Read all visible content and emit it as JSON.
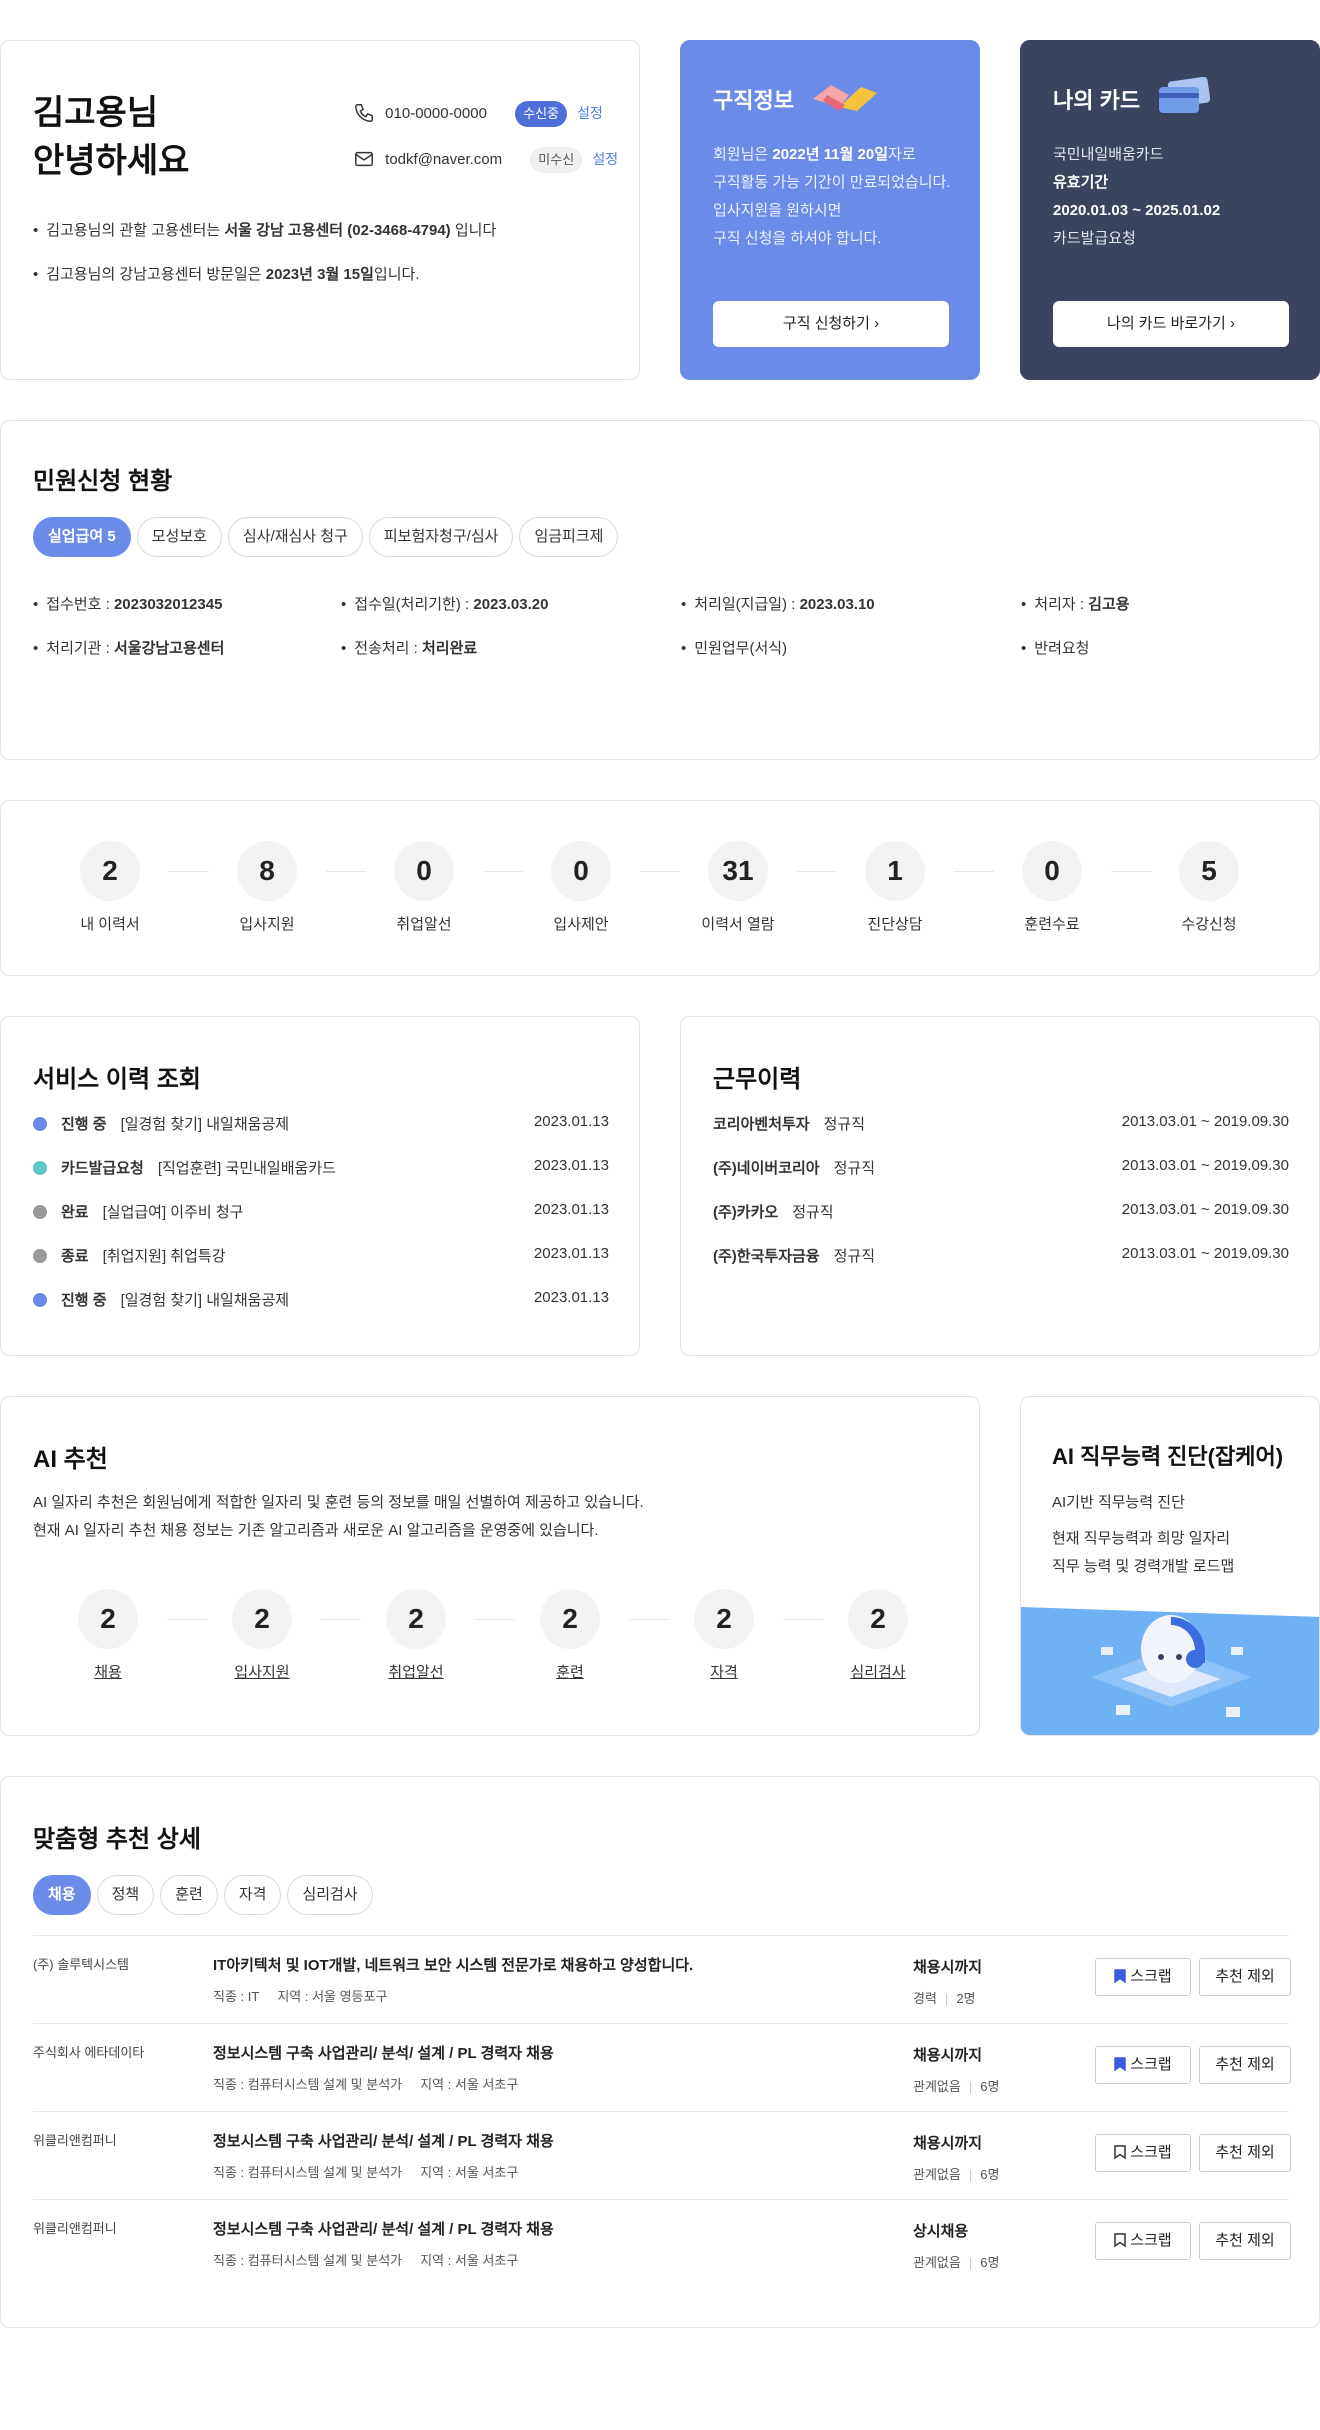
{
  "profile": {
    "greeting_line1": "김고용님",
    "greeting_line2": "안녕하세요",
    "phone": "010-0000-0000",
    "phone_badge": "수신중",
    "phone_setting": "설정",
    "email": "todkf@naver.com",
    "email_badge": "미수신",
    "email_setting": "설정",
    "info1_pre": "김고용님의 관할 고용센터는 ",
    "info1_bold": "서울 강남 고용센터 (02-3468-4794)",
    "info1_post": " 입니다",
    "info2_pre": "김고용님의 강남고용센터 방문일은 ",
    "info2_bold": "2023년 3월 15일",
    "info2_post": "입니다."
  },
  "job_info": {
    "title": "구직정보",
    "l1_pre": "회원님은 ",
    "l1_bold": "2022년 11월 20일",
    "l1_post": "자로",
    "l2": "구직활동 가능 기간이 만료되었습니다.",
    "l3": "입사지원을 원하시면",
    "l4": "구직 신청을 하셔야 합니다.",
    "button": "구직 신청하기",
    "colors": {
      "bg": "#6b8be8"
    }
  },
  "my_card": {
    "title": "나의 카드",
    "l1": "국민내일배움카드",
    "l2": "유효기간",
    "l3": "2020.01.03 ~ 2025.01.02",
    "l4": "카드발급요청",
    "button": "나의 카드 바로가기",
    "colors": {
      "bg": "#3a4460"
    }
  },
  "civil": {
    "title": "민원신청 현황",
    "tabs": [
      "실업급여 5",
      "모성보호",
      "심사/재심사 청구",
      "피보험자청구/심사",
      "임금피크제"
    ],
    "items": [
      {
        "label": "접수번호 : ",
        "value": "2023032012345"
      },
      {
        "label": "접수일(처리기한) : ",
        "value": "2023.03.20"
      },
      {
        "label": "처리일(지급일) : ",
        "value": "2023.03.10"
      },
      {
        "label": "처리자 : ",
        "value": "김고용"
      },
      {
        "label": "처리기관 : ",
        "value": "서울강남고용센터"
      },
      {
        "label": "전송처리 : ",
        "value": "처리완료"
      },
      {
        "label": "민원업무(서식)",
        "value": ""
      },
      {
        "label": "반려요청",
        "value": ""
      }
    ]
  },
  "stats": [
    {
      "value": "2",
      "label": "내 이력서"
    },
    {
      "value": "8",
      "label": "입사지원"
    },
    {
      "value": "0",
      "label": "취업알선"
    },
    {
      "value": "0",
      "label": "입사제안"
    },
    {
      "value": "31",
      "label": "이력서 열람"
    },
    {
      "value": "1",
      "label": "진단상담"
    },
    {
      "value": "0",
      "label": "훈련수료"
    },
    {
      "value": "5",
      "label": "수강신청"
    }
  ],
  "service": {
    "title": "서비스 이력 조회",
    "rows": [
      {
        "status": "진행 중",
        "text": "[일경험 찾기] 내일채움공제",
        "date": "2023.01.13",
        "color": "#6b8be8"
      },
      {
        "status": "카드발급요청",
        "text": "[직업훈련] 국민내일배움카드",
        "date": "2023.01.13",
        "color": "#5ec7c9"
      },
      {
        "status": "완료",
        "text": "[실업급여] 이주비 청구",
        "date": "2023.01.13",
        "color": "#9a9a9a"
      },
      {
        "status": "종료",
        "text": "[취업지원] 취업특강",
        "date": "2023.01.13",
        "color": "#9a9a9a"
      },
      {
        "status": "진행 중",
        "text": "[일경험 찾기] 내일채움공제",
        "date": "2023.01.13",
        "color": "#6b8be8"
      }
    ]
  },
  "work": {
    "title": "근무이력",
    "rows": [
      {
        "company": "코리아벤처투자",
        "type": "정규직",
        "period": "2013.03.01 ~ 2019.09.30"
      },
      {
        "company": "(주)네이버코리아",
        "type": "정규직",
        "period": "2013.03.01 ~ 2019.09.30"
      },
      {
        "company": "(주)카카오",
        "type": "정규직",
        "period": "2013.03.01 ~ 2019.09.30"
      },
      {
        "company": "(주)한국투자금융",
        "type": "정규직",
        "period": "2013.03.01 ~ 2019.09.30"
      }
    ]
  },
  "ai": {
    "title": "AI 추천",
    "desc1": "AI 일자리 추천은 회원님에게 적합한 일자리 및 훈련 등의 정보를 매일 선별하여 제공하고 있습니다.",
    "desc2": "현재 AI 일자리 추천 채용 정보는 기존 알고리즘과 새로운 AI 알고리즘을 운영중에 있습니다.",
    "stats": [
      {
        "value": "2",
        "label": "채용"
      },
      {
        "value": "2",
        "label": "입사지원"
      },
      {
        "value": "2",
        "label": "취업알선"
      },
      {
        "value": "2",
        "label": "훈련"
      },
      {
        "value": "2",
        "label": "자격"
      },
      {
        "value": "2",
        "label": "심리검사"
      }
    ]
  },
  "diag": {
    "title": "AI 직무능력 진단(잡케어)",
    "l1": "AI기반 직무능력 진단",
    "l2": "현재 직무능력과 희망 일자리",
    "l3": "직무 능력 및 경력개발 로드맵",
    "colors": {
      "bg": "#6fb1f5"
    }
  },
  "custom": {
    "title": "맞춤형 추천 상세",
    "tabs": [
      "채용",
      "정책",
      "훈련",
      "자격",
      "심리검사"
    ],
    "jobs": [
      {
        "company": "(주) 솔루텍시스템",
        "title": "IT아키텍처 및 IOT개발, 네트워크 보안 시스템 전문가로 채용하고 양성합니다.",
        "meta1": "직종 : IT",
        "meta2": "지역 : 서울 영등포구",
        "deadline": "채용시까지",
        "cond1": "경력",
        "cond2": "2명",
        "scrap": "스크랩",
        "exclude": "추천 제외",
        "scrapped": true
      },
      {
        "company": "주식회사 에타데이타",
        "title": "정보시스템 구축 사업관리/ 분석/ 설계 / PL 경력자 채용",
        "meta1": "직종 : 컴퓨터시스템 설계 및 분석가",
        "meta2": "지역 : 서울 서초구",
        "deadline": "채용시까지",
        "cond1": "관계없음",
        "cond2": "6명",
        "scrap": "스크랩",
        "exclude": "추천 제외",
        "scrapped": true
      },
      {
        "company": "위클리앤컴퍼니",
        "title": "정보시스템 구축 사업관리/ 분석/ 설계 / PL 경력자 채용",
        "meta1": "직종 : 컴퓨터시스템 설계 및 분석가",
        "meta2": "지역 : 서울 서초구",
        "deadline": "채용시까지",
        "cond1": "관계없음",
        "cond2": "6명",
        "scrap": "스크랩",
        "exclude": "추천 제외",
        "scrapped": false
      },
      {
        "company": "위클리앤컴퍼니",
        "title": "정보시스템 구축 사업관리/ 분석/ 설계 / PL 경력자 채용",
        "meta1": "직종 : 컴퓨터시스템 설계 및 분석가",
        "meta2": "지역 : 서울 서초구",
        "deadline": "상시채용",
        "cond1": "관계없음",
        "cond2": "6명",
        "scrap": "스크랩",
        "exclude": "추천 제외",
        "scrapped": false
      }
    ]
  }
}
